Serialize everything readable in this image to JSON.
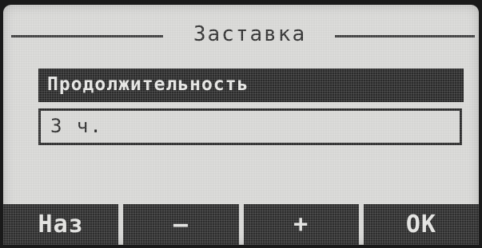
{
  "screen": {
    "title": "Заставка",
    "parameter_label": "Продолжительность",
    "value": "3 ч."
  },
  "softkeys": {
    "back": "Наз",
    "minus": "—",
    "plus": "+",
    "ok": "OK"
  },
  "colors": {
    "lcd_background": "#d6d6d4",
    "lcd_dark": "#2b2b2b",
    "lcd_light_text": "#e4e4e2"
  }
}
